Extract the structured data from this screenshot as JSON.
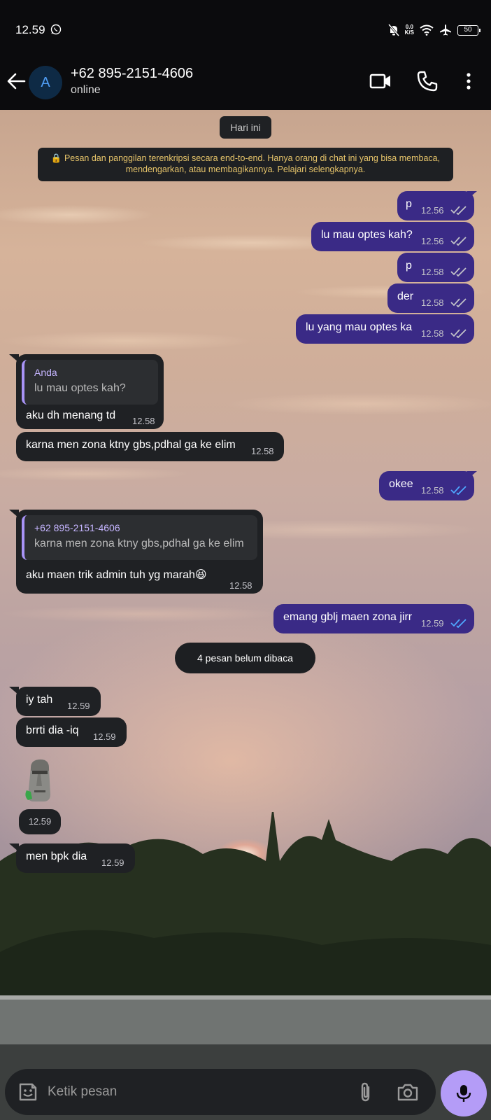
{
  "status_bar": {
    "time": "12.59",
    "speed_top": "0.0",
    "speed_bottom": "K/S",
    "battery": "50"
  },
  "header": {
    "avatar_letter": "A",
    "contact_name": "+62 895-2151-4606",
    "contact_status": "online"
  },
  "date_chip": "Hari ini",
  "encryption_notice": "🔒 Pesan dan panggilan terenkripsi secara end-to-end. Hanya orang di chat ini yang bisa membaca, mendengarkan, atau membagikannya. Pelajari selengkapnya.",
  "unread_banner": "4 pesan belum dibaca",
  "messages": [
    {
      "dir": "out",
      "text": "p",
      "time": "12.56"
    },
    {
      "dir": "out",
      "text": "lu mau optes kah?",
      "time": "12.56"
    },
    {
      "dir": "out",
      "text": "p",
      "time": "12.58"
    },
    {
      "dir": "out",
      "text": "der",
      "time": "12.58"
    },
    {
      "dir": "out",
      "text": "lu yang mau optes ka",
      "time": "12.58"
    },
    {
      "dir": "in",
      "quote_author": "Anda",
      "quote_text": "lu mau optes kah?",
      "text": "aku dh menang td",
      "time": "12.58"
    },
    {
      "dir": "in",
      "text": "karna men zona ktny gbs,pdhal ga ke elim",
      "time": "12.58"
    },
    {
      "dir": "out",
      "text": "okee",
      "time": "12.58"
    },
    {
      "dir": "in",
      "quote_author": "+62 895-2151-4606",
      "quote_text": "karna men zona ktny gbs,pdhal ga ke elim",
      "text": "aku maen trik admin tuh yg marah😆",
      "time": "12.58"
    },
    {
      "dir": "out",
      "text": "emang gblj maen zona jirr",
      "time": "12.59"
    },
    {
      "dir": "in",
      "text": "iy tah",
      "time": "12.59"
    },
    {
      "dir": "in",
      "text": "brrti dia -iq",
      "time": "12.59"
    },
    {
      "dir": "in",
      "sticker": "moai-sticker",
      "time": "12.59"
    },
    {
      "dir": "in",
      "text": "men bpk dia",
      "time": "12.59"
    }
  ],
  "composer": {
    "placeholder": "Ketik pesan"
  },
  "colors": {
    "outgoing_bubble": "#3a2a86",
    "incoming_bubble": "#1f2124",
    "read_ticks": "#4fa8ff",
    "mic_button": "#b49cf7",
    "quote_bar": "#a893f6",
    "encryption_text": "#e6c46a"
  },
  "icons": [
    "whatsapp-icon",
    "mute-bell-icon",
    "wifi-icon",
    "airplane-icon",
    "battery-icon",
    "back-arrow-icon",
    "video-call-icon",
    "voice-call-icon",
    "more-options-icon",
    "double-check-icon",
    "emoji-icon",
    "attach-icon",
    "camera-icon",
    "mic-icon"
  ]
}
